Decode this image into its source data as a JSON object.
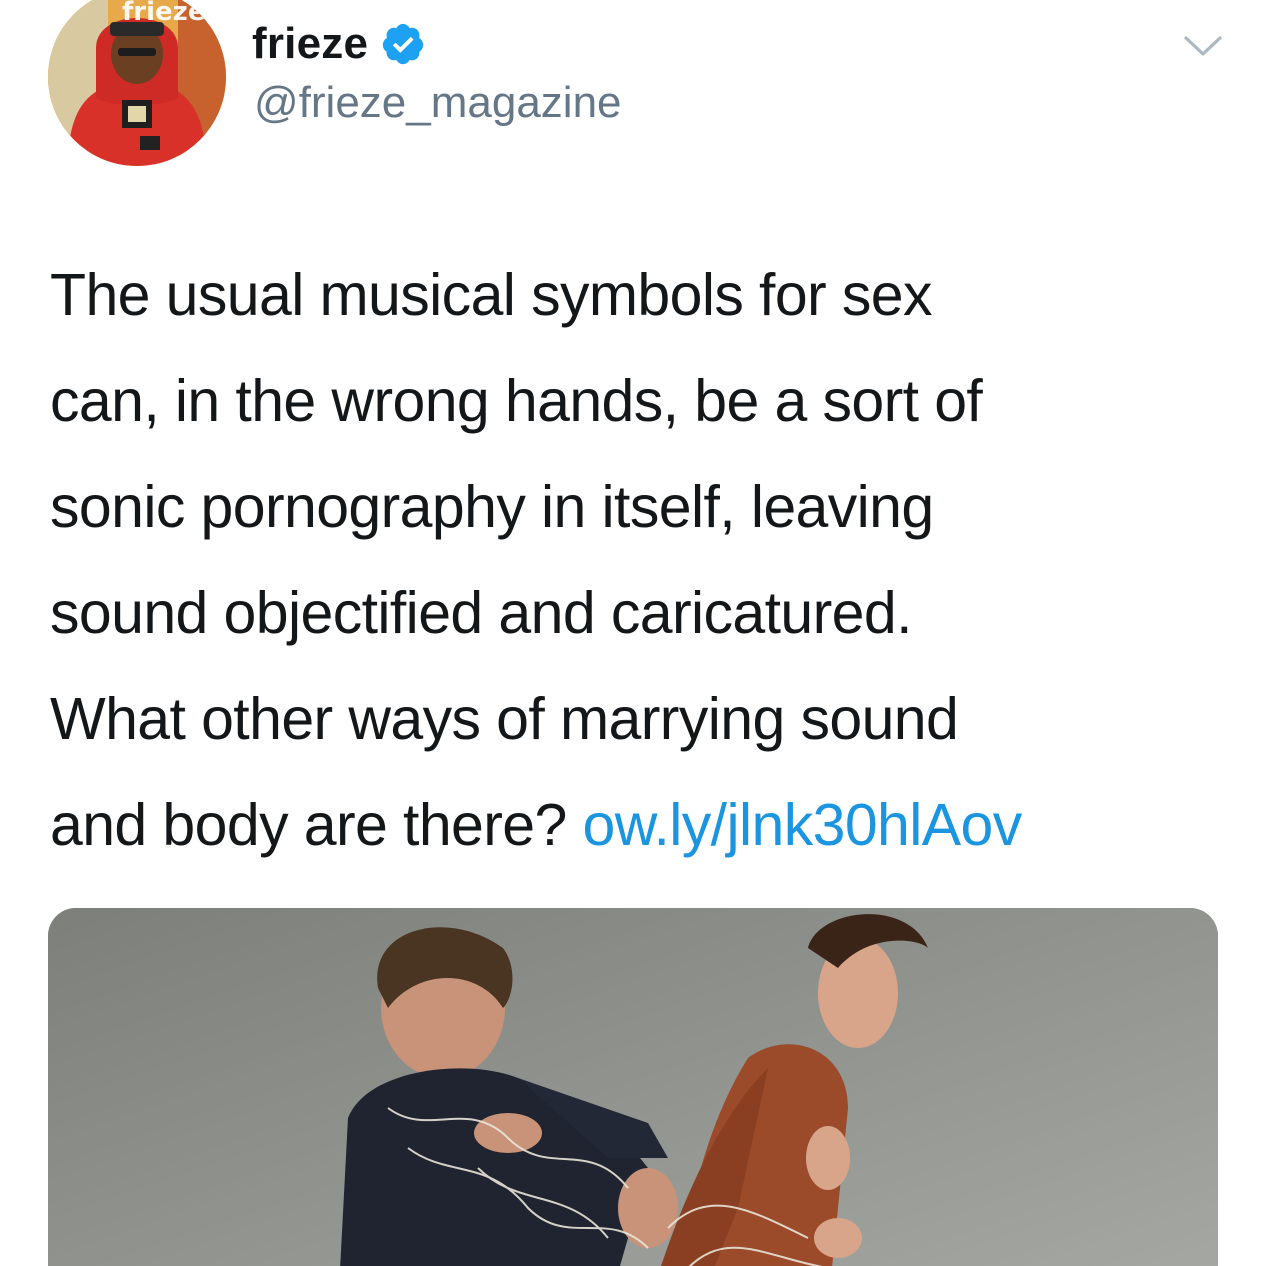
{
  "tweet": {
    "display_name": "frieze",
    "handle": "@frieze_magazine",
    "verified": true,
    "text_lines": [
      "The usual musical symbols for sex",
      "can, in the wrong hands, be a sort of",
      "sonic pornography in itself, leaving",
      "sound objectified and caricatured.",
      "What other ways of marrying sound",
      "and body are there? "
    ],
    "link_text": "ow.ly/jlnk30hlAov",
    "avatar_logo_text": "frieze",
    "media_alt": "photo"
  },
  "icons": {
    "verified": "verified-badge-icon",
    "menu": "chevron-down-icon"
  },
  "colors": {
    "text": "#14171a",
    "secondary": "#657786",
    "link": "#1b95e0",
    "verified": "#1da1f2"
  }
}
